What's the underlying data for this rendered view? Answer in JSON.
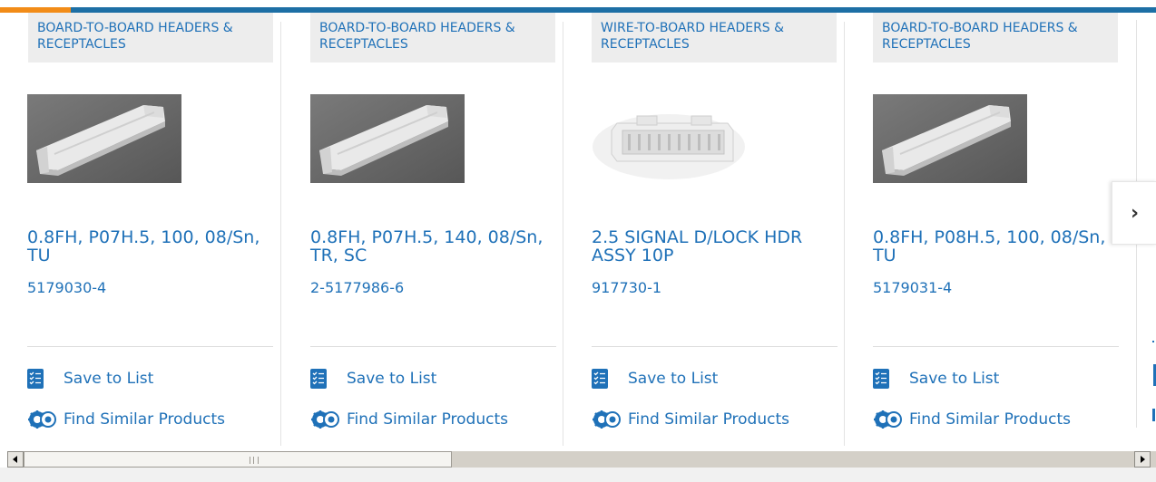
{
  "colors": {
    "accent_blue": "#1f71b8",
    "top_bar_blue": "#1d6fa5",
    "top_bar_orange": "#f28c18"
  },
  "products": [
    {
      "category": "BOARD-TO-BOARD HEADERS & RECEPTACLES",
      "name": "0.8FH, P07H.5, 100, 08/Sn, TU",
      "part_number": "5179030-4",
      "image": "grey-connector-photo",
      "save_label": "Save to List",
      "find_label": "Find Similar Products"
    },
    {
      "category": "BOARD-TO-BOARD HEADERS & RECEPTACLES",
      "name": "0.8FH, P07H.5, 140, 08/Sn, TR, SC",
      "part_number": "2-5177986-6",
      "image": "grey-connector-photo",
      "save_label": "Save to List",
      "find_label": "Find Similar Products"
    },
    {
      "category": "WIRE-TO-BOARD HEADERS & RECEPTACLES",
      "name": "2.5 SIGNAL D/LOCK HDR ASSY 10P",
      "part_number": "917730-1",
      "image": "white-header-photo",
      "save_label": "Save to List",
      "find_label": "Find Similar Products"
    },
    {
      "category": "BOARD-TO-BOARD HEADERS & RECEPTACLES",
      "name": "0.8FH, P08H.5, 100, 08/Sn, TU",
      "part_number": "5179031-4",
      "image": "grey-connector-photo",
      "save_label": "Save to List",
      "find_label": "Find Similar Products"
    }
  ],
  "carousel": {
    "next_icon": "chevron-right-icon",
    "next_glyph": "›"
  }
}
